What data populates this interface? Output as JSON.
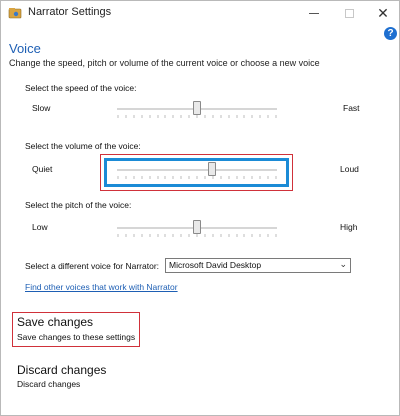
{
  "window": {
    "title": "Narrator Settings"
  },
  "help": {
    "glyph": "?"
  },
  "header": {
    "heading": "Voice",
    "subheading": "Change the speed, pitch or volume of the current voice or choose a new voice"
  },
  "speed": {
    "label": "Select the speed of the voice:",
    "min_label": "Slow",
    "max_label": "Fast",
    "value": 0.5
  },
  "volume": {
    "label": "Select the volume of the voice:",
    "min_label": "Quiet",
    "max_label": "Loud",
    "value": 0.6
  },
  "pitch": {
    "label": "Select the pitch of the voice:",
    "min_label": "Low",
    "max_label": "High",
    "value": 0.5
  },
  "voice_select": {
    "label": "Select a different voice for Narrator:",
    "value": "Microsoft David Desktop"
  },
  "links": {
    "other_voices": "Find other voices that work with Narrator"
  },
  "actions": {
    "save": {
      "title": "Save changes",
      "description": "Save changes to these settings"
    },
    "discard": {
      "title": "Discard changes",
      "description": "Discard changes"
    }
  },
  "colors": {
    "accent": "#1e5fb4",
    "focus_blue": "#1b8bd6",
    "highlight_red": "#d0313a"
  }
}
